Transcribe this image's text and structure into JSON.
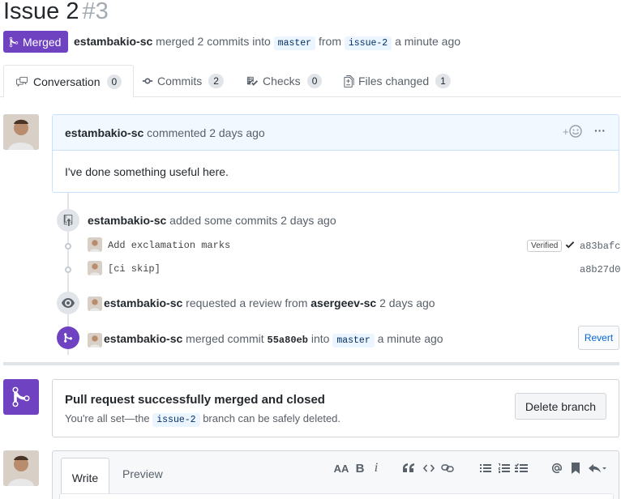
{
  "header": {
    "title": "Issue 2",
    "number": "#3",
    "state_badge": "Merged",
    "author": "estambakio-sc",
    "action_text": "merged 2 commits into",
    "base_branch": "master",
    "from_text": "from",
    "head_branch": "issue-2",
    "time": "a minute ago"
  },
  "tabs": [
    {
      "label": "Conversation",
      "count": "0"
    },
    {
      "label": "Commits",
      "count": "2"
    },
    {
      "label": "Checks",
      "count": "0"
    },
    {
      "label": "Files changed",
      "count": "1"
    }
  ],
  "comment": {
    "author": "estambakio-sc",
    "action": "commented",
    "time": "2 days ago",
    "body": "I've done something useful here.",
    "reaction_label": "+",
    "more_label": "···"
  },
  "timeline": {
    "commits_event": {
      "author": "estambakio-sc",
      "text": "added some commits",
      "time": "2 days ago"
    },
    "commits": [
      {
        "message": "Add exclamation marks",
        "verified": "Verified",
        "sha": "a83bafc"
      },
      {
        "message": "[ci skip]",
        "sha": "a8b27d0"
      }
    ],
    "review_event": {
      "author": "estambakio-sc",
      "text": "requested a review from",
      "reviewer": "asergeev-sc",
      "time": "2 days ago"
    },
    "merge_event": {
      "author": "estambakio-sc",
      "text": "merged commit",
      "sha": "55a80eb",
      "into": "into",
      "branch": "master",
      "time": "a minute ago",
      "revert_label": "Revert"
    }
  },
  "merged_box": {
    "title": "Pull request successfully merged and closed",
    "subtitle_before": "You're all set—the",
    "branch": "issue-2",
    "subtitle_after": "branch can be safely deleted.",
    "delete_label": "Delete branch"
  },
  "editor": {
    "write_label": "Write",
    "preview_label": "Preview",
    "toolbar": {
      "heading": "AA",
      "bold": "B",
      "italic": "i"
    }
  },
  "colors": {
    "merged_purple": "#6f42c1",
    "link_blue": "#0366d6",
    "comment_border": "#c8e1ff"
  }
}
